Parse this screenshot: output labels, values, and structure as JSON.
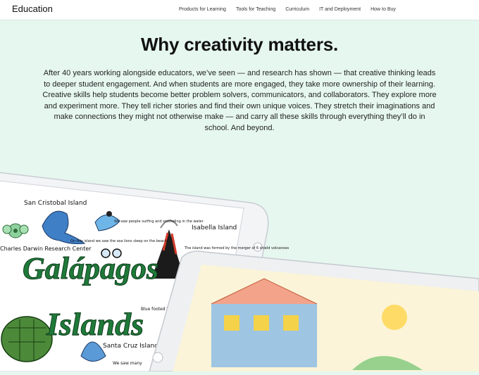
{
  "brand": {
    "label": "Education"
  },
  "nav": {
    "items": [
      {
        "label": "Products for Learning"
      },
      {
        "label": "Tools for Teaching"
      },
      {
        "label": "Curriculum"
      },
      {
        "label": "IT and Deployment"
      },
      {
        "label": "How to Buy"
      }
    ]
  },
  "hero": {
    "title": "Why creativity matters.",
    "body": "After 40 years working alongside educators, we’ve seen — and research has shown — that creative thinking leads to deeper student engagement. And when students are more engaged, they take more ownership of their learning. Creative skills help students become better problem solvers, communicators, and collaborators. They explore more and experiment more. They tell richer stories and find their own unique voices. They stretch their imaginations and make connections they might not otherwise make — and carry all these skills through everything they’ll do in school. And beyond."
  },
  "illustration": {
    "big_word_1": "Galápagos",
    "big_word_2": "Islands",
    "labels": {
      "san_cristobal": "San Cristobal Island",
      "isabella": "Isabella Island",
      "santa_cruz": "Santa Cruz Island",
      "blue_footed": "Blue footed booby",
      "surfing_note": "We saw people surfing and snorkeling in the water",
      "seals_note": "On this island we saw the sea lions sleep on the beach!",
      "volcano_note": "The island was formed by the merger of 6 shield volcanoes",
      "we_saw": "We saw many",
      "charles": "Charles Darwin Research Center"
    }
  },
  "colors": {
    "background": "#e6f7f0",
    "nav_bg": "#ffffff",
    "ink": "#1d1d1f",
    "green": "#1f7a3a"
  }
}
